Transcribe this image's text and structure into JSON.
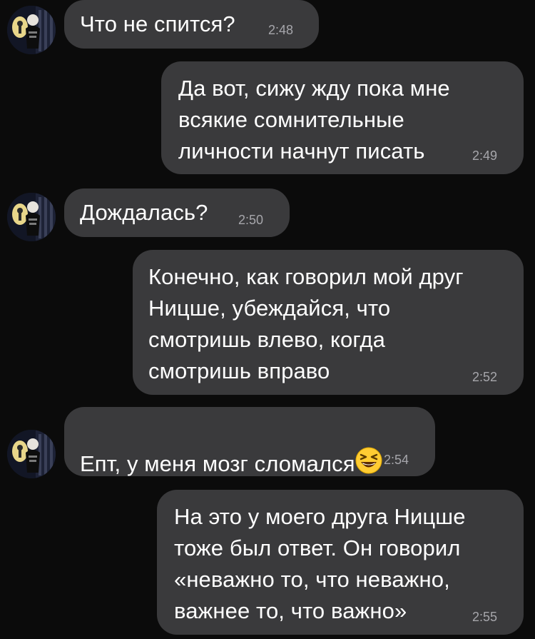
{
  "conversation": {
    "messages": [
      {
        "side": "incoming",
        "text": "Что не спится?",
        "time": "2:48"
      },
      {
        "side": "outgoing",
        "text": "Да вот, сижу жду пока мне\nвсякие сомнительные\nличности начнут писать",
        "time": "2:49"
      },
      {
        "side": "incoming",
        "text": "Дождалась?",
        "time": "2:50"
      },
      {
        "side": "outgoing",
        "text": "Конечно, как говорил мой друг\nНицше, убеждайся, что\nсмотришь влево, когда\nсмотришь вправо",
        "time": "2:52"
      },
      {
        "side": "incoming",
        "text": "Епт, у меня мозг сломался",
        "emoji": "grinning-squinting-face",
        "time": "2:54"
      },
      {
        "side": "outgoing",
        "text": "На это у моего друга Ницше\nтоже был ответ. Он говорил\n«неважно то, что неважно,\nважнее то, что важно»",
        "time": "2:55"
      }
    ]
  },
  "theme": {
    "background": "#0b0b0b",
    "bubble": "#3a3a3c",
    "text": "#ffffff",
    "time": "#a6a6ab"
  }
}
